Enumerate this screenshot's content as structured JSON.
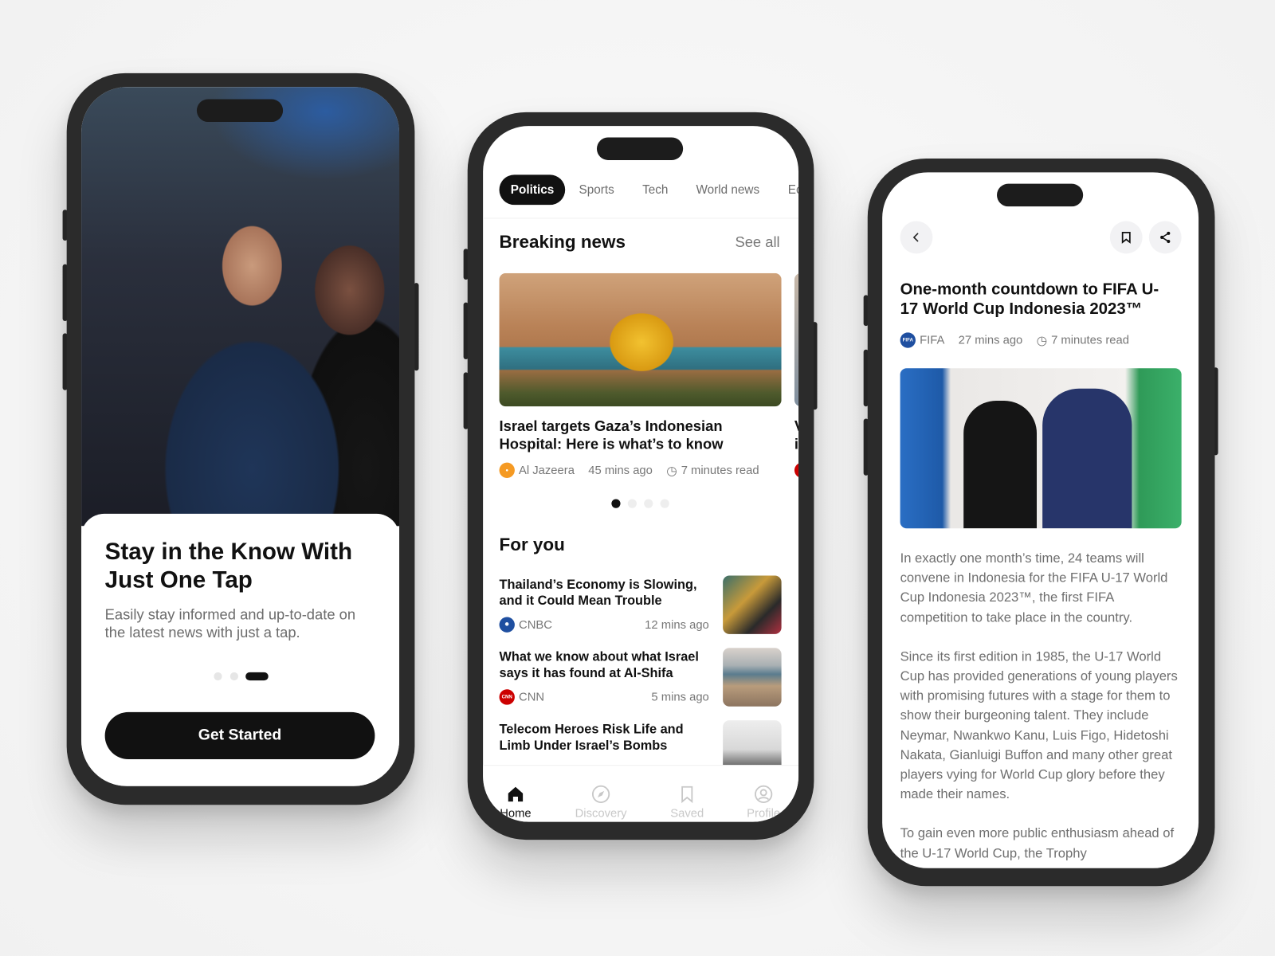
{
  "onboarding": {
    "title": "Stay in the Know With Just One Tap",
    "subtitle": "Easily stay informed and up-to-date on the latest news with just a tap.",
    "page_indicator": {
      "pages": 3,
      "active": 3
    },
    "cta_label": "Get Started"
  },
  "home": {
    "tabs": [
      {
        "label": "Politics",
        "active": true
      },
      {
        "label": "Sports"
      },
      {
        "label": "Tech"
      },
      {
        "label": "World news"
      },
      {
        "label": "Ec"
      }
    ],
    "breaking": {
      "title": "Breaking news",
      "see_all": "See all",
      "card": {
        "headline": "Israel targets Gaza’s Indonesian Hospital: Here is what’s to know",
        "source": "Al Jazeera",
        "time": "45 mins ago",
        "read": "7 minutes read"
      },
      "next_card_peek": {
        "headline": "V i"
      },
      "carousel": {
        "pages": 4,
        "active": 1
      }
    },
    "for_you": {
      "title": "For you",
      "items": [
        {
          "headline": "Thailand’s Economy is Slowing, and it Could Mean Trouble",
          "source": "CNBC",
          "time": "12 mins ago"
        },
        {
          "headline": "What we know about what Israel says it has found at Al-Shifa",
          "source": "CNN",
          "time": "5 mins ago"
        },
        {
          "headline": "Telecom Heroes Risk Life and Limb Under Israel’s Bombs"
        }
      ]
    },
    "nav": [
      {
        "label": "Home",
        "icon": "home-icon",
        "active": true
      },
      {
        "label": "Discovery",
        "icon": "compass-icon"
      },
      {
        "label": "Saved",
        "icon": "bookmark-icon"
      },
      {
        "label": "Profile",
        "icon": "user-icon"
      }
    ]
  },
  "article": {
    "title": "One-month countdown to FIFA U-17 World Cup Indonesia 2023™",
    "source": "FIFA",
    "source_logo_text": "FIFA",
    "time": "27 mins ago",
    "read": "7 minutes read",
    "paragraphs": [
      "In exactly one month’s time, 24 teams will convene in Indonesia for the FIFA U-17 World Cup Indonesia 2023™, the first FIFA competition to take place in the country.",
      "Since its first edition in 1985, the U-17 World Cup has provided generations of young players with promising futures with a stage for them to show their burgeoning talent. They include Neymar, Nwankwo Kanu, Luis Figo, Hidetoshi Nakata, Gianluigi Buffon and many other great players vying for World Cup glory before they made their names.",
      "To gain even more public enthusiasm ahead of the U-17 World Cup, the Trophy"
    ]
  },
  "colors": {
    "accent": "#111111",
    "muted": "#6f6f6f",
    "inactive_nav": "#c8c8c8",
    "aljazeera": "#f59a23",
    "cnn": "#cc0000",
    "fifa": "#1f4fa0"
  }
}
